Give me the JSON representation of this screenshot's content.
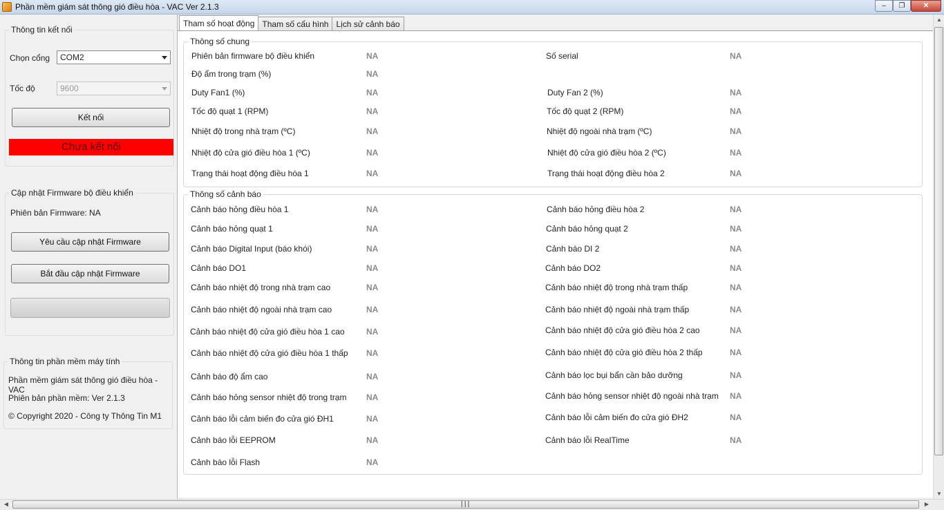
{
  "window": {
    "title": "Phần mềm giám sát thông gió điều hòa - VAC Ver 2.1.3",
    "minimize_icon": "minimize-icon",
    "maximize_icon": "maximize-icon",
    "close_icon": "close-icon"
  },
  "connection": {
    "group_label": "Thông tin kết nối",
    "port_label": "Chọn cổng",
    "port_value": "COM2",
    "baud_label": "Tốc độ",
    "baud_value": "9600",
    "connect_button": "Kết nối",
    "status_text": "Chưa kết nối",
    "status_color": "#ff0000"
  },
  "firmware": {
    "group_label": "Cập nhật Firmware bộ điều khiển",
    "version_text": "Phiên bản Firmware: NA",
    "request_button": "Yêu cầu cập nhật Firmware",
    "start_button": "Bắt đầu cập nhật Firmware",
    "progress": 0
  },
  "software": {
    "group_label": "Thông tin phần mềm máy tính",
    "name": "Phần mềm giám sát thông gió điều hòa - VAC",
    "version": "Phiên bản phần mềm: Ver 2.1.3",
    "copyright": "© Copyright 2020 - Công ty Thông Tin M1"
  },
  "tabs": [
    {
      "label": "Tham số hoạt động",
      "active": true
    },
    {
      "label": "Tham số cấu hình",
      "active": false
    },
    {
      "label": "Lịch sử cảnh báo",
      "active": false
    }
  ],
  "general": {
    "group_label": "Thông số chung",
    "params": [
      {
        "label": "Phiên bản firmware bộ điều khiển",
        "value": "NA"
      },
      {
        "label": "Số serial",
        "value": "NA"
      },
      {
        "label": "Độ ẩm trong trạm (%)",
        "value": "NA"
      },
      {
        "label": "Duty Fan1 (%)",
        "value": "NA"
      },
      {
        "label": "Duty Fan 2 (%)",
        "value": "NA"
      },
      {
        "label": "Tốc độ quạt 1 (RPM)",
        "value": "NA"
      },
      {
        "label": "Tốc độ quạt 2 (RPM)",
        "value": "NA"
      },
      {
        "label": "Nhiệt độ trong nhà trạm (ºC)",
        "value": "NA"
      },
      {
        "label": "Nhiệt độ ngoài nhà trạm (ºC)",
        "value": "NA"
      },
      {
        "label": "Nhiệt độ cửa gió điều hòa 1 (ºC)",
        "value": "NA"
      },
      {
        "label": "Nhiệt độ cửa gió điều hòa 2 (ºC)",
        "value": "NA"
      },
      {
        "label": "Trạng thái hoạt động điều hòa 1",
        "value": "NA"
      },
      {
        "label": "Trạng thái hoạt động điều hòa 2",
        "value": "NA"
      }
    ]
  },
  "alarms": {
    "group_label": "Thông số cảnh báo",
    "params": [
      {
        "label": "Cảnh báo hỏng điều hòa 1",
        "value": "NA"
      },
      {
        "label": "Cảnh báo hỏng điều hòa 2",
        "value": "NA"
      },
      {
        "label": "Cảnh báo hỏng quạt 1",
        "value": "NA"
      },
      {
        "label": "Cảnh báo hỏng quạt 2",
        "value": "NA"
      },
      {
        "label": "Cảnh báo Digital Input (báo khói)",
        "value": "NA"
      },
      {
        "label": "Cảnh báo DI 2",
        "value": "NA"
      },
      {
        "label": "Cảnh báo DO1",
        "value": "NA"
      },
      {
        "label": "Cảnh báo DO2",
        "value": "NA"
      },
      {
        "label": "Cảnh báo nhiệt độ trong nhà trạm cao",
        "value": "NA"
      },
      {
        "label": "Cảnh báo nhiệt độ trong nhà trạm thấp",
        "value": "NA"
      },
      {
        "label": "Cảnh báo nhiệt độ ngoài nhà trạm cao",
        "value": "NA"
      },
      {
        "label": "Cảnh báo nhiệt độ ngoài nhà trạm thấp",
        "value": "NA"
      },
      {
        "label": "Cảnh báo nhiệt độ cửa gió điều hòa 1 cao",
        "value": "NA"
      },
      {
        "label": "Cảnh báo nhiệt độ cửa gió điều hòa 2 cao",
        "value": "NA"
      },
      {
        "label": "Cảnh báo nhiệt độ cửa gió điều hòa 1 thấp",
        "value": "NA"
      },
      {
        "label": "Cảnh báo nhiệt độ cửa gió điều hòa 2 thấp",
        "value": "NA"
      },
      {
        "label": "Cảnh báo độ ẩm cao",
        "value": "NA"
      },
      {
        "label": "Cảnh báo lọc bụi bẩn cần bảo dưỡng",
        "value": "NA"
      },
      {
        "label": "Cảnh báo hỏng sensor nhiệt độ trong trạm",
        "value": "NA"
      },
      {
        "label": "Cảnh báo hỏng sensor nhiệt độ ngoài nhà trạm",
        "value": "NA"
      },
      {
        "label": "Cảnh báo lỗi cảm biến đo cửa gió ĐH1",
        "value": "NA"
      },
      {
        "label": "Cảnh báo lỗi cảm biến đo cửa gió ĐH2",
        "value": "NA"
      },
      {
        "label": "Cảnh báo lỗi EEPROM",
        "value": "NA"
      },
      {
        "label": "Cảnh báo lỗi RealTime",
        "value": "NA"
      },
      {
        "label": "Cảnh báo lỗi Flash",
        "value": "NA"
      }
    ]
  }
}
